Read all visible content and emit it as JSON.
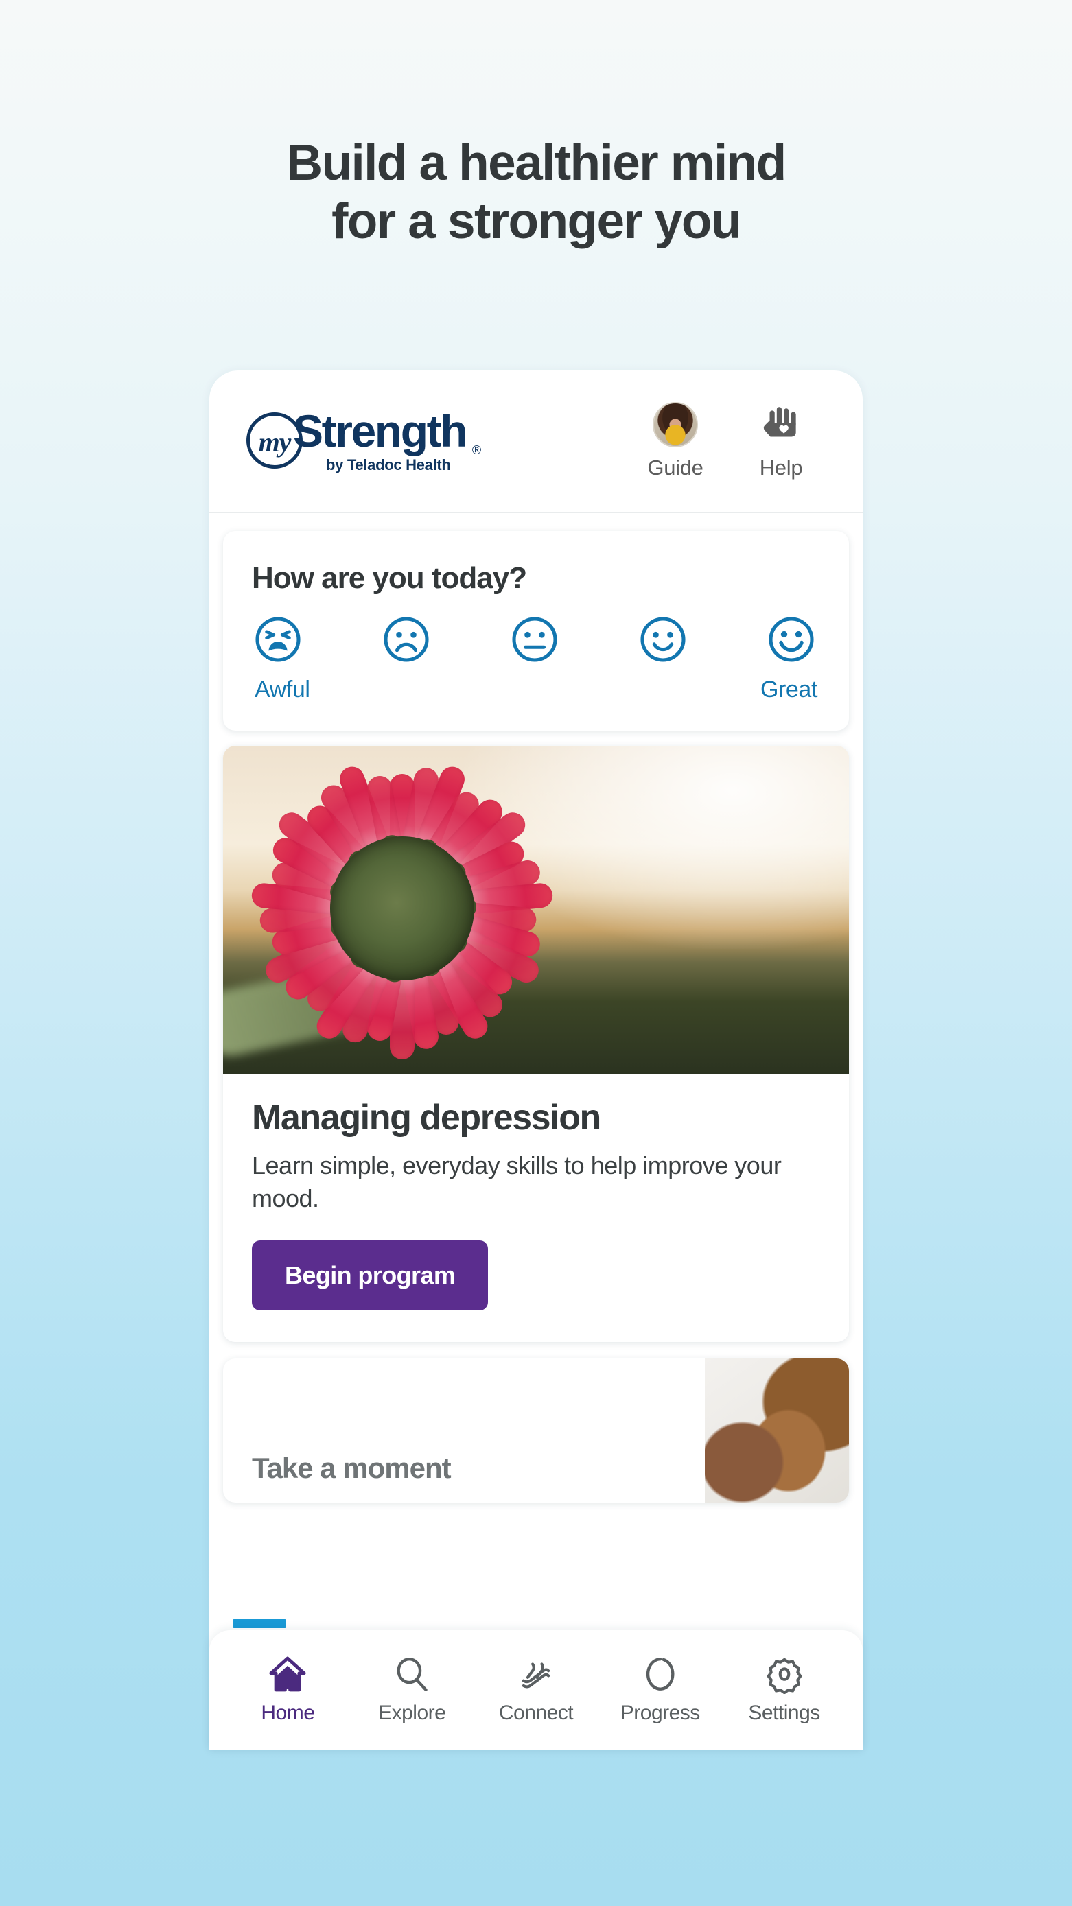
{
  "headline": {
    "line1": "Build a healthier mind",
    "line2": "for a stronger you"
  },
  "colors": {
    "brand_navy": "#10355f",
    "accent_blue": "#1276b0",
    "purple": "#5b2d8e",
    "nav_active": "#4b2a7f",
    "nav_accent": "#1a9ad6",
    "bg_top": "#f6f9f9",
    "bg_bottom": "#a8ddf0",
    "text_dark": "#33383a"
  },
  "app_header": {
    "logo": {
      "mark_text": "my",
      "wordmark": "Strength",
      "registered": "®",
      "tagline": "by Teladoc Health"
    },
    "actions": [
      {
        "label": "Guide",
        "icon": "avatar-photo-icon"
      },
      {
        "label": "Help",
        "icon": "hand-heart-icon"
      }
    ]
  },
  "mood_card": {
    "title": "How are you today?",
    "faces": [
      {
        "name": "awful-face-icon",
        "mood": "Awful"
      },
      {
        "name": "sad-face-icon",
        "mood": "Bad"
      },
      {
        "name": "neutral-face-icon",
        "mood": "Okay"
      },
      {
        "name": "slight-smile-face-icon",
        "mood": "Good"
      },
      {
        "name": "happy-face-icon",
        "mood": "Great"
      }
    ],
    "low_label": "Awful",
    "high_label": "Great"
  },
  "program_card": {
    "image_alt": "Pink daisy flower with dew drops at sunset",
    "title": "Managing depression",
    "description": "Learn simple, everyday skills to help improve your mood.",
    "cta_label": "Begin program"
  },
  "moment_card": {
    "title": "Take a moment",
    "image_alt": "Person with clasped hands resting"
  },
  "bottom_nav": {
    "items": [
      {
        "label": "Home",
        "icon": "home-icon",
        "active": true
      },
      {
        "label": "Explore",
        "icon": "search-icon",
        "active": false
      },
      {
        "label": "Connect",
        "icon": "connect-icon",
        "active": false
      },
      {
        "label": "Progress",
        "icon": "progress-ring-icon",
        "active": false
      },
      {
        "label": "Settings",
        "icon": "gear-icon",
        "active": false
      }
    ]
  }
}
